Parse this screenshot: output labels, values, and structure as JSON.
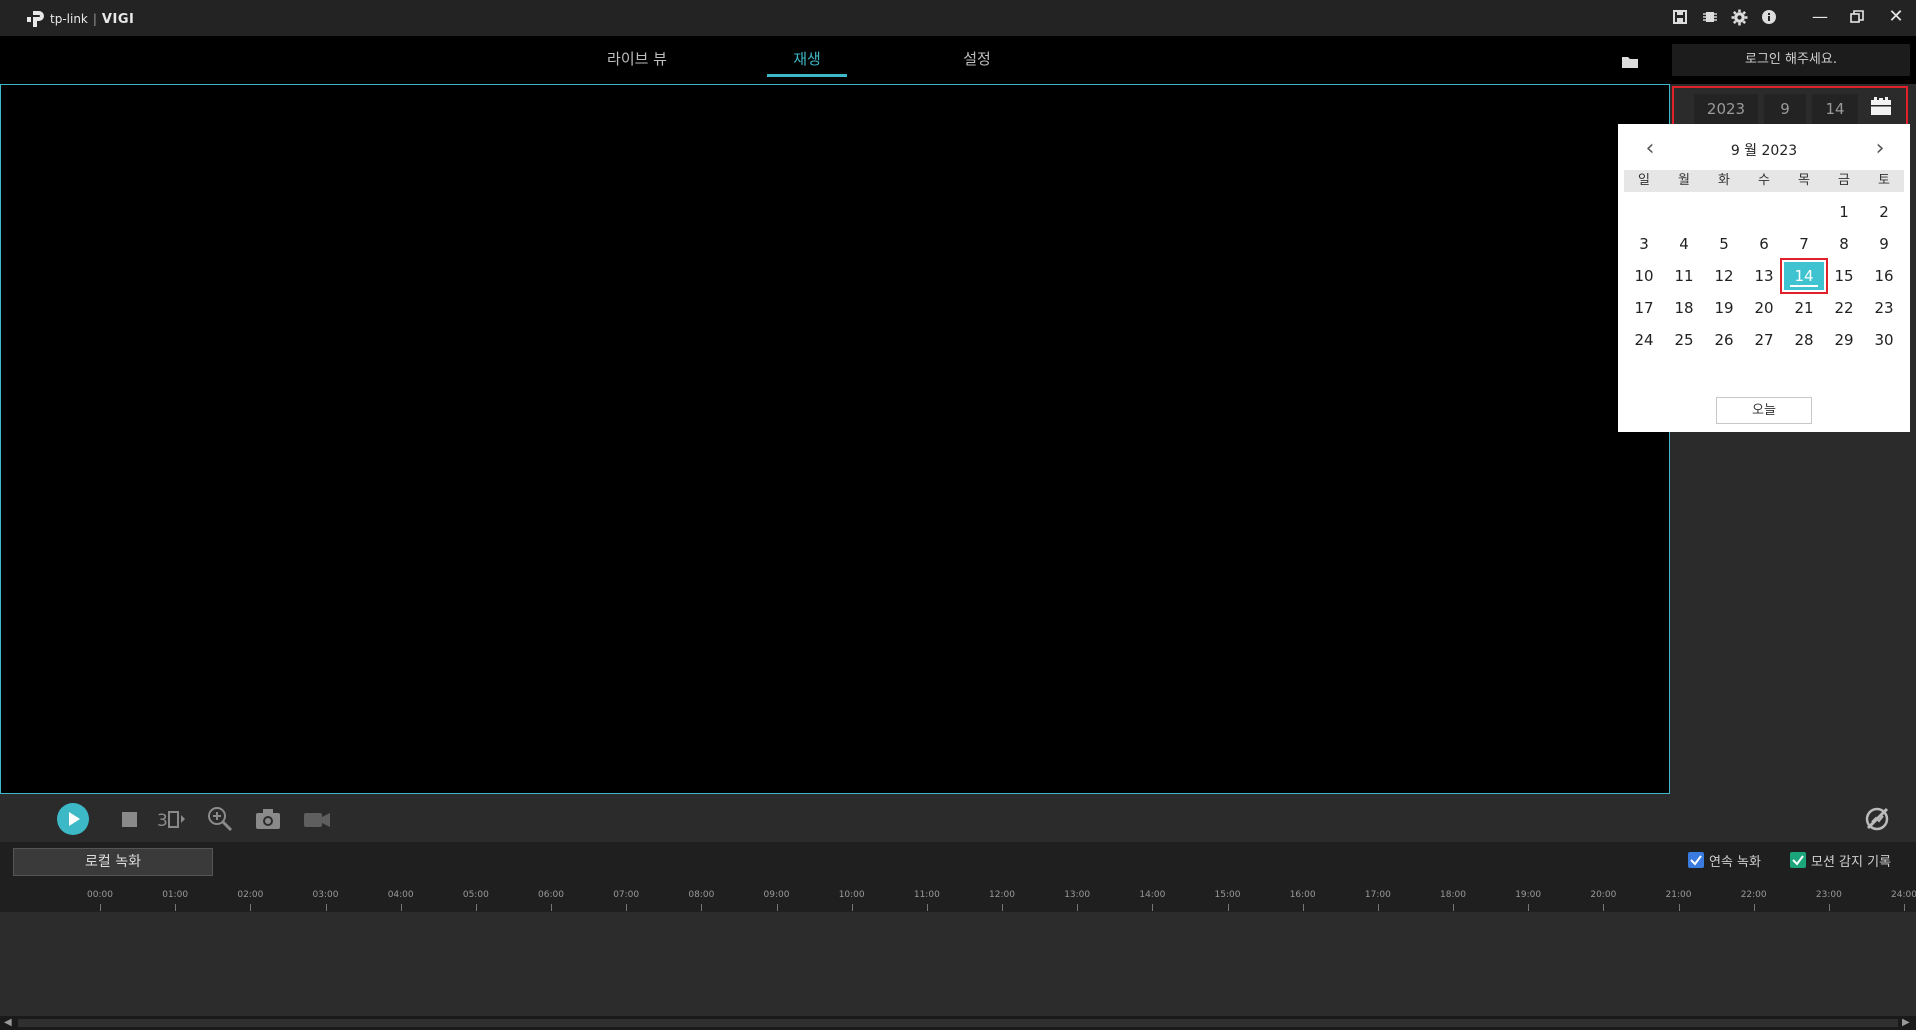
{
  "app": {
    "brand": "tp-link",
    "product": "VIGI"
  },
  "titlebar": {
    "icons": [
      "save-icon",
      "chip-icon",
      "gear-icon",
      "info-icon"
    ],
    "window_controls": [
      "minimize-icon",
      "restore-icon",
      "close-icon"
    ]
  },
  "nav": {
    "tabs": [
      {
        "label": "라이브 뷰",
        "active": false
      },
      {
        "label": "재생",
        "active": true
      },
      {
        "label": "설정",
        "active": false
      }
    ]
  },
  "login": {
    "label": "로그인 해주세요."
  },
  "date": {
    "year": "2023",
    "month": "9",
    "day": "14"
  },
  "calendar": {
    "header": "9 월 2023",
    "weekdays": [
      "일",
      "월",
      "화",
      "수",
      "목",
      "금",
      "토"
    ],
    "weeks": [
      [
        "",
        "",
        "",
        "",
        "",
        "1",
        "2"
      ],
      [
        "3",
        "4",
        "5",
        "6",
        "7",
        "8",
        "9"
      ],
      [
        "10",
        "11",
        "12",
        "13",
        "14",
        "15",
        "16"
      ],
      [
        "17",
        "18",
        "19",
        "20",
        "21",
        "22",
        "23"
      ],
      [
        "24",
        "25",
        "26",
        "27",
        "28",
        "29",
        "30"
      ]
    ],
    "selected": "14",
    "today_label": "오늘"
  },
  "recording": {
    "local_button": "로컬 녹화",
    "continuous_label": "연속 녹화",
    "motion_label": "모션 감지 기록",
    "continuous_color": "#3a7be0",
    "motion_color": "#1aa57a"
  },
  "timeline": {
    "ticks": [
      "00:00",
      "01:00",
      "02:00",
      "03:00",
      "04:00",
      "05:00",
      "06:00",
      "07:00",
      "08:00",
      "09:00",
      "10:00",
      "11:00",
      "12:00",
      "13:00",
      "14:00",
      "15:00",
      "16:00",
      "17:00",
      "18:00",
      "19:00",
      "20:00",
      "21:00",
      "22:00",
      "23:00",
      "24:00"
    ]
  },
  "colors": {
    "accent": "#3db8c6",
    "highlight": "#e0202a"
  }
}
